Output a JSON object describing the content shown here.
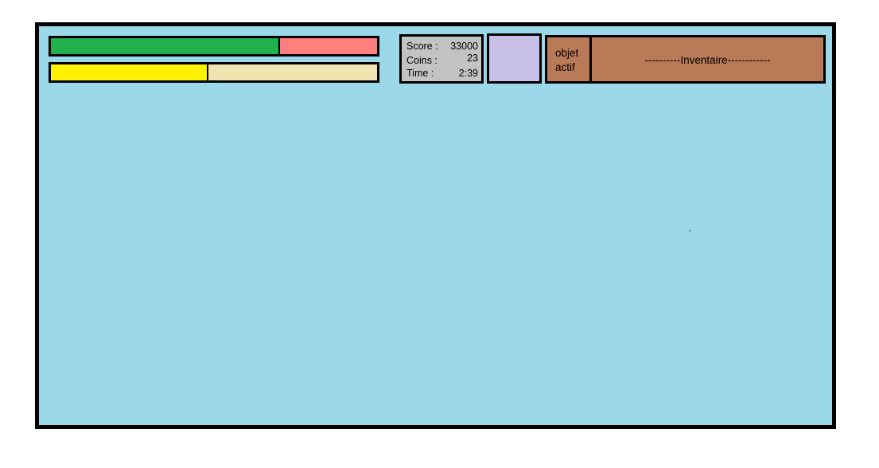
{
  "hud": {
    "health": {
      "fraction": 0.7,
      "fill_color": "#22b14c",
      "empty_color": "#ff7f7f"
    },
    "energy": {
      "fraction": 0.48,
      "fill_color": "#fff200",
      "empty_color": "#efe4b0"
    },
    "stats": {
      "score_label": "Score :",
      "score_value": "33000",
      "coins_label": "Coins :",
      "coins_value": "23",
      "time_label": "Time :",
      "time_value": "2:39"
    },
    "inventory": {
      "active_object_line1": "objet",
      "active_object_line2": "actif",
      "label": "----------Inventaire------------"
    }
  },
  "colors": {
    "play_area": "#9bd8e9",
    "stats_panel": "#c3c3c3",
    "item_slot": "#c8bfe7",
    "inventory_panel": "#b97a57"
  }
}
